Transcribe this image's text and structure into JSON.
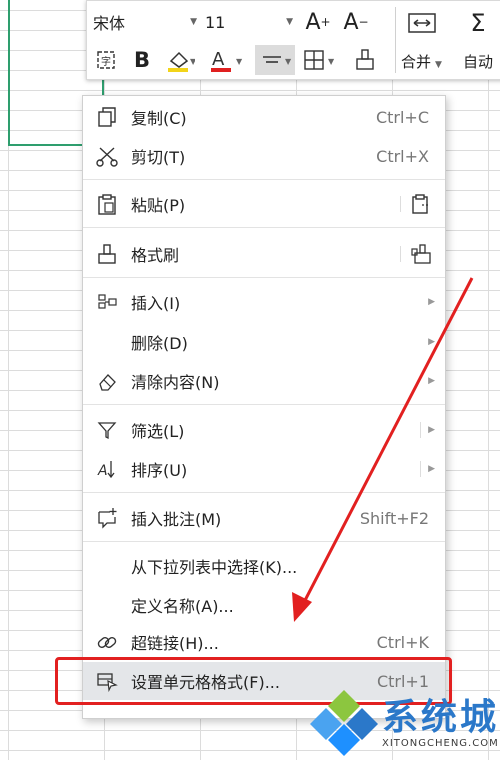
{
  "toolbar": {
    "font_name": "宋体",
    "font_size": "11",
    "merge_label": "合并",
    "wrap_label": "自动"
  },
  "menu": {
    "items": [
      {
        "label": "复制(C)",
        "shortcut": "Ctrl+C"
      },
      {
        "label": "剪切(T)",
        "shortcut": "Ctrl+X"
      },
      {
        "label": "粘贴(P)"
      },
      {
        "label": "格式刷"
      },
      {
        "label": "插入(I)"
      },
      {
        "label": "删除(D)"
      },
      {
        "label": "清除内容(N)"
      },
      {
        "label": "筛选(L)"
      },
      {
        "label": "排序(U)"
      },
      {
        "label": "插入批注(M)",
        "shortcut": "Shift+F2"
      },
      {
        "label": "从下拉列表中选择(K)..."
      },
      {
        "label": "定义名称(A)..."
      },
      {
        "label": "超链接(H)...",
        "shortcut": "Ctrl+K"
      },
      {
        "label": "设置单元格格式(F)...",
        "shortcut": "Ctrl+1"
      }
    ]
  },
  "watermark": {
    "title": "系统城",
    "subtitle": "XITONGCHENG.COM"
  },
  "colors": {
    "selection": "#2e9e6e",
    "annotation_red": "#e22020",
    "watermark_blue": "#2b78c9"
  }
}
